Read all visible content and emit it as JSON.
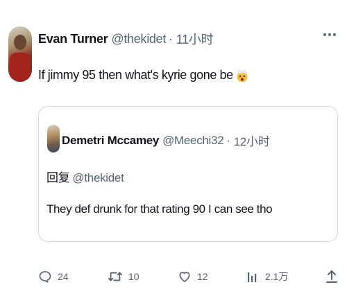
{
  "author": {
    "name": "Evan Turner",
    "handle": "@thekidet",
    "separator": "·",
    "time": "11小时"
  },
  "tweet": {
    "text": "If jimmy 95 then what's kyrie gone be",
    "emoji_icon": "exploding-head-icon"
  },
  "quote": {
    "author": {
      "name": "Demetri Mccamey",
      "handle": "@Meechi32",
      "separator": "·",
      "time": "12小时"
    },
    "reply_prefix": "回复",
    "reply_to": "@thekidet",
    "text": "They def drunk for that rating 90 I can see tho"
  },
  "actions": {
    "replies": "24",
    "retweets": "10",
    "likes": "12",
    "views": "2.1万"
  },
  "colors": {
    "text": "#0f1419",
    "secondary": "#536471",
    "border": "#cfd9de"
  }
}
